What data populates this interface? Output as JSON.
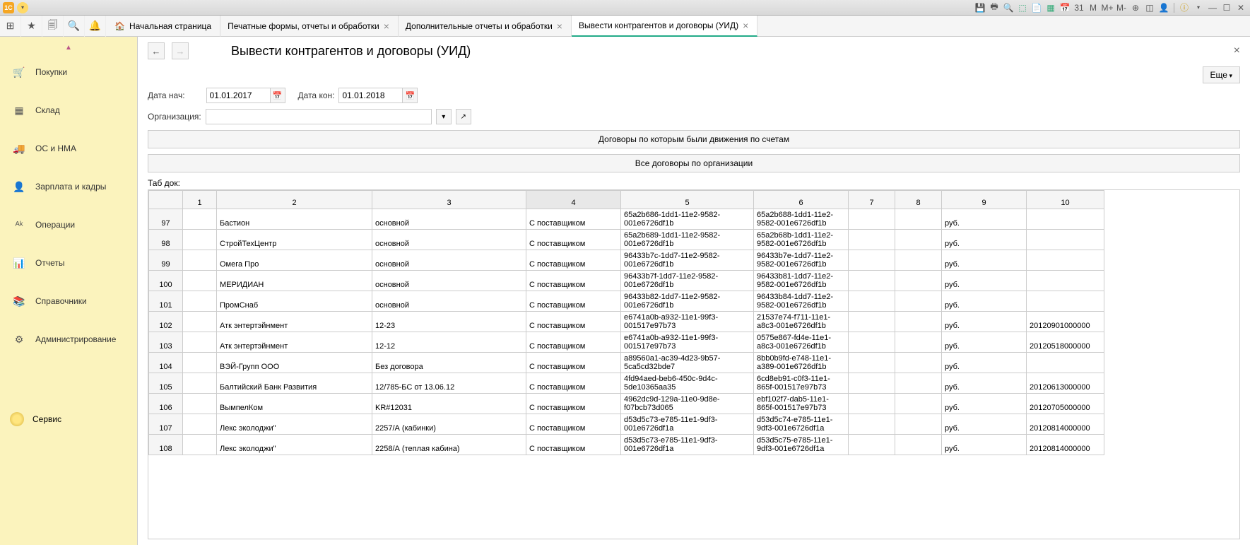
{
  "window": {
    "badge": "1C"
  },
  "toolbar_icons": {
    "apps": "⊞",
    "star": "★",
    "doc": "🗐",
    "search": "🔍",
    "bell": "🔔"
  },
  "home_label": "Начальная страница",
  "tabs": [
    {
      "label": "Печатные формы, отчеты и обработки",
      "active": false,
      "close": true
    },
    {
      "label": "Дополнительные отчеты и обработки",
      "active": false,
      "close": true
    },
    {
      "label": "Вывести контрагентов и договоры (УИД)",
      "active": true,
      "close": true
    }
  ],
  "sidebar": {
    "items": [
      {
        "icon": "🛒",
        "label": "Покупки"
      },
      {
        "icon": "▦",
        "label": "Склад"
      },
      {
        "icon": "🚚",
        "label": "ОС и НМА"
      },
      {
        "icon": "👤",
        "label": "Зарплата и кадры"
      },
      {
        "icon": "ᴬᵏ",
        "label": "Операции"
      },
      {
        "icon": "📊",
        "label": "Отчеты"
      },
      {
        "icon": "📚",
        "label": "Справочники"
      },
      {
        "icon": "⚙",
        "label": "Администрирование"
      }
    ],
    "service_label": "Сервис"
  },
  "page": {
    "title": "Вывести контрагентов и договоры (УИД)",
    "more_label": "Еще",
    "date_start_label": "Дата нач:",
    "date_start_value": "01.01.2017",
    "date_end_label": "Дата кон:",
    "date_end_value": "01.01.2018",
    "org_label": "Организация:",
    "org_value": "",
    "btn1": "Договоры по которым были движения по счетам",
    "btn2": "Все договоры по организации",
    "table_label": "Таб док:",
    "columns": [
      "1",
      "2",
      "3",
      "4",
      "5",
      "6",
      "7",
      "8",
      "9",
      "10"
    ],
    "rows": [
      {
        "num": "97",
        "c2": "Бастион",
        "c3": "основной",
        "c4": "С поставщиком",
        "c5": "65a2b686-1dd1-11e2-9582-001e6726df1b",
        "c6": "65a2b688-1dd1-11e2-9582-001e6726df1b",
        "c7": "",
        "c8": "",
        "c9": "руб.",
        "c10": ""
      },
      {
        "num": "98",
        "c2": "СтройТехЦентр",
        "c3": "основной",
        "c4": "С поставщиком",
        "c5": "65a2b689-1dd1-11e2-9582-001e6726df1b",
        "c6": "65a2b68b-1dd1-11e2-9582-001e6726df1b",
        "c7": "",
        "c8": "",
        "c9": "руб.",
        "c10": ""
      },
      {
        "num": "99",
        "c2": "Омега Про",
        "c3": "основной",
        "c4": "С поставщиком",
        "c5": "96433b7c-1dd7-11e2-9582-001e6726df1b",
        "c6": "96433b7e-1dd7-11e2-9582-001e6726df1b",
        "c7": "",
        "c8": "",
        "c9": "руб.",
        "c10": ""
      },
      {
        "num": "100",
        "c2": "МЕРИДИАН",
        "c3": "основной",
        "c4": "С поставщиком",
        "c5": "96433b7f-1dd7-11e2-9582-001e6726df1b",
        "c6": "96433b81-1dd7-11e2-9582-001e6726df1b",
        "c7": "",
        "c8": "",
        "c9": "руб.",
        "c10": ""
      },
      {
        "num": "101",
        "c2": "ПромСнаб",
        "c3": "основной",
        "c4": "С поставщиком",
        "c5": "96433b82-1dd7-11e2-9582-001e6726df1b",
        "c6": "96433b84-1dd7-11e2-9582-001e6726df1b",
        "c7": "",
        "c8": "",
        "c9": "руб.",
        "c10": ""
      },
      {
        "num": "102",
        "c2": "Атк энтертэйнмент",
        "c3": "12-23",
        "c4": "С поставщиком",
        "c5": "e6741a0b-a932-11e1-99f3-001517e97b73",
        "c6": "21537e74-f711-11e1-a8c3-001e6726df1b",
        "c7": "",
        "c8": "",
        "c9": "руб.",
        "c10": "20120901000000"
      },
      {
        "num": "103",
        "c2": "Атк энтертэйнмент",
        "c3": "12-12",
        "c4": "С поставщиком",
        "c5": "e6741a0b-a932-11e1-99f3-001517e97b73",
        "c6": "0575e867-fd4e-11e1-a8c3-001e6726df1b",
        "c7": "",
        "c8": "",
        "c9": "руб.",
        "c10": "20120518000000"
      },
      {
        "num": "104",
        "c2": "ВЭЙ-Групп ООО",
        "c3": "Без договора",
        "c4": "С поставщиком",
        "c5": "a89560a1-ac39-4d23-9b57-5ca5cd32bde7",
        "c6": "8bb0b9fd-e748-11e1-a389-001e6726df1b",
        "c7": "",
        "c8": "",
        "c9": "руб.",
        "c10": ""
      },
      {
        "num": "105",
        "c2": "Балтийский Банк Развития",
        "c3": "12/785-БС от 13.06.12",
        "c4": "С поставщиком",
        "c5": "4fd94aed-beb6-450c-9d4c-5de10365aa35",
        "c6": "6cd8eb91-c0f3-11e1-865f-001517e97b73",
        "c7": "",
        "c8": "",
        "c9": "руб.",
        "c10": "20120613000000"
      },
      {
        "num": "106",
        "c2": "ВымпелКом",
        "c3": "KR#12031",
        "c4": "С поставщиком",
        "c5": "4962dc9d-129a-11e0-9d8e-f07bcb73d065",
        "c6": "ebf102f7-dab5-11e1-865f-001517e97b73",
        "c7": "",
        "c8": "",
        "c9": "руб.",
        "c10": "20120705000000"
      },
      {
        "num": "107",
        "c2": "Лекс эколоджи\"",
        "c3": "2257/А (кабинки)",
        "c4": "С поставщиком",
        "c5": "d53d5c73-e785-11e1-9df3-001e6726df1a",
        "c6": "d53d5c74-e785-11e1-9df3-001e6726df1a",
        "c7": "",
        "c8": "",
        "c9": "руб.",
        "c10": "20120814000000"
      },
      {
        "num": "108",
        "c2": "Лекс эколоджи\"",
        "c3": "2258/А (теплая кабина)",
        "c4": "С поставщиком",
        "c5": "d53d5c73-e785-11e1-9df3-001e6726df1a",
        "c6": "d53d5c75-e785-11e1-9df3-001e6726df1a",
        "c7": "",
        "c8": "",
        "c9": "руб.",
        "c10": "20120814000000"
      }
    ]
  }
}
